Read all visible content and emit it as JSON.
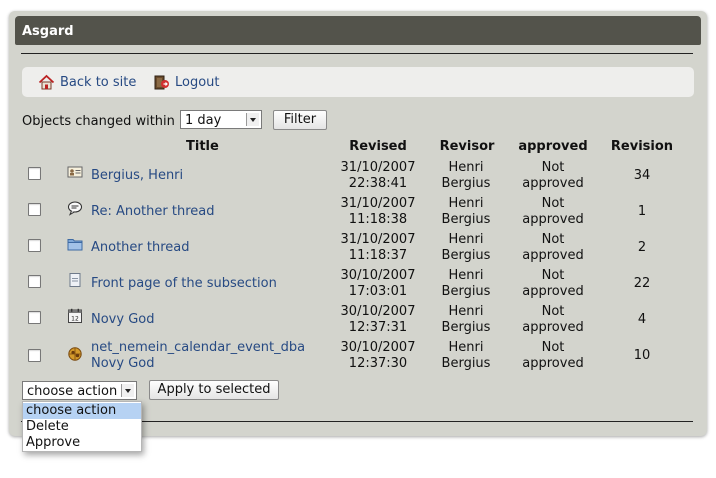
{
  "app": {
    "title": "Asgard"
  },
  "nav": {
    "back_label": "Back to site",
    "logout_label": "Logout"
  },
  "filter": {
    "label": "Objects changed within",
    "selected": "1 day",
    "button": "Filter"
  },
  "table": {
    "headers": {
      "title": "Title",
      "revised": "Revised",
      "revisor": "Revisor",
      "approved": "approved",
      "revision": "Revision"
    },
    "rows": [
      {
        "icon": "person-card-icon",
        "title": "Bergius, Henri",
        "date": "31/10/2007",
        "time": "22:38:41",
        "revisor_first": "Henri",
        "revisor_last": "Bergius",
        "status_1": "Not",
        "status_2": "approved",
        "revision": "34"
      },
      {
        "icon": "speech-bubble-icon",
        "title": "Re: Another thread",
        "date": "31/10/2007",
        "time": "11:18:38",
        "revisor_first": "Henri",
        "revisor_last": "Bergius",
        "status_1": "Not",
        "status_2": "approved",
        "revision": "1"
      },
      {
        "icon": "folder-icon",
        "title": "Another thread",
        "date": "31/10/2007",
        "time": "11:18:37",
        "revisor_first": "Henri",
        "revisor_last": "Bergius",
        "status_1": "Not",
        "status_2": "approved",
        "revision": "2"
      },
      {
        "icon": "document-icon",
        "title": "Front page of the subsection",
        "date": "30/10/2007",
        "time": "17:03:01",
        "revisor_first": "Henri",
        "revisor_last": "Bergius",
        "status_1": "Not",
        "status_2": "approved",
        "revision": "22"
      },
      {
        "icon": "calendar-icon",
        "title": "Novy God",
        "date": "30/10/2007",
        "time": "12:37:31",
        "revisor_first": "Henri",
        "revisor_last": "Bergius",
        "status_1": "Not",
        "status_2": "approved",
        "revision": "4"
      },
      {
        "icon": "object-icon",
        "title_line1": "net_nemein_calendar_event_dba",
        "title_line2": "Novy God",
        "date": "30/10/2007",
        "time": "12:37:30",
        "revisor_first": "Henri",
        "revisor_last": "Bergius",
        "status_1": "Not",
        "status_2": "approved",
        "revision": "10"
      }
    ]
  },
  "action": {
    "selected": "choose action",
    "button": "Apply to selected",
    "options": [
      "choose action",
      "Delete",
      "Approve"
    ]
  }
}
